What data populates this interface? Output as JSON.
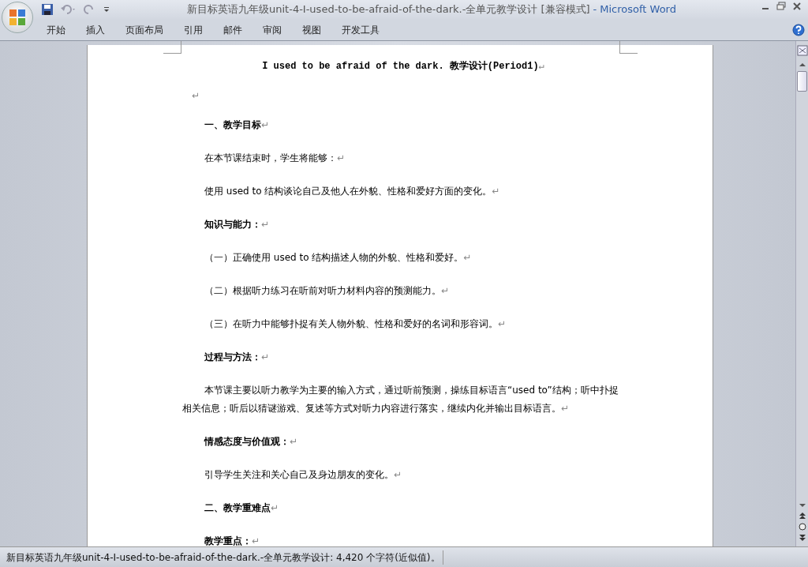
{
  "window": {
    "title": "新目标英语九年级unit-4-I-used-to-be-afraid-of-the-dark.-全单元教学设计 [兼容模式]",
    "app": "- Microsoft Word"
  },
  "ribbon_tabs": [
    {
      "label": "开始",
      "selected": false
    },
    {
      "label": "插入",
      "selected": false
    },
    {
      "label": "页面布局",
      "selected": false
    },
    {
      "label": "引用",
      "selected": false
    },
    {
      "label": "邮件",
      "selected": false
    },
    {
      "label": "审阅",
      "selected": false
    },
    {
      "label": "视图",
      "selected": false
    },
    {
      "label": "开发工具",
      "selected": false
    }
  ],
  "document": {
    "paragraphs": [
      {
        "kind": "title",
        "text": "I used to be afraid of the dark. 教学设计(Period1)",
        "mark": "↵"
      },
      {
        "kind": "empty",
        "mark": "↵"
      },
      {
        "kind": "heading",
        "text": "一、教学目标",
        "mark": "↵"
      },
      {
        "kind": "body",
        "text": "在本节课结束时，学生将能够：",
        "mark": "↵"
      },
      {
        "kind": "body",
        "text": "使用 used to  结构谈论自己及他人在外貌、性格和爱好方面的变化。",
        "mark": "↵"
      },
      {
        "kind": "heading",
        "text": "知识与能力：",
        "mark": "↵"
      },
      {
        "kind": "body",
        "text": "（一）正确使用 used to 结构描述人物的外貌、性格和爱好。",
        "mark": "↵"
      },
      {
        "kind": "body",
        "text": "（二）根据听力练习在听前对听力材料内容的预测能力。",
        "mark": "↵"
      },
      {
        "kind": "body",
        "text": "（三）在听力中能够扑捉有关人物外貌、性格和爱好的名词和形容词。",
        "mark": "↵"
      },
      {
        "kind": "heading",
        "text": "过程与方法：",
        "mark": "↵"
      },
      {
        "kind": "indented",
        "text": "本节课主要以听力教学为主要的输入方式，通过听前预测，操练目标语言“used to”结构；听中扑捉相关信息；听后以猜谜游戏、复述等方式对听力内容进行落实，继续内化并输出目标语言。",
        "mark": "↵"
      },
      {
        "kind": "heading",
        "text": "情感态度与价值观：",
        "mark": "↵"
      },
      {
        "kind": "body",
        "text": "引导学生关注和关心自己及身边朋友的变化。",
        "mark": "↵"
      },
      {
        "kind": "heading",
        "text": "二、教学重难点",
        "mark": "↵"
      },
      {
        "kind": "heading",
        "text": "教学重点：",
        "mark": "↵"
      }
    ]
  },
  "status_bar": {
    "text": "新目标英语九年级unit-4-I-used-to-be-afraid-of-the-dark.-全单元教学设计: 4,420 个字符(近似值)。"
  }
}
